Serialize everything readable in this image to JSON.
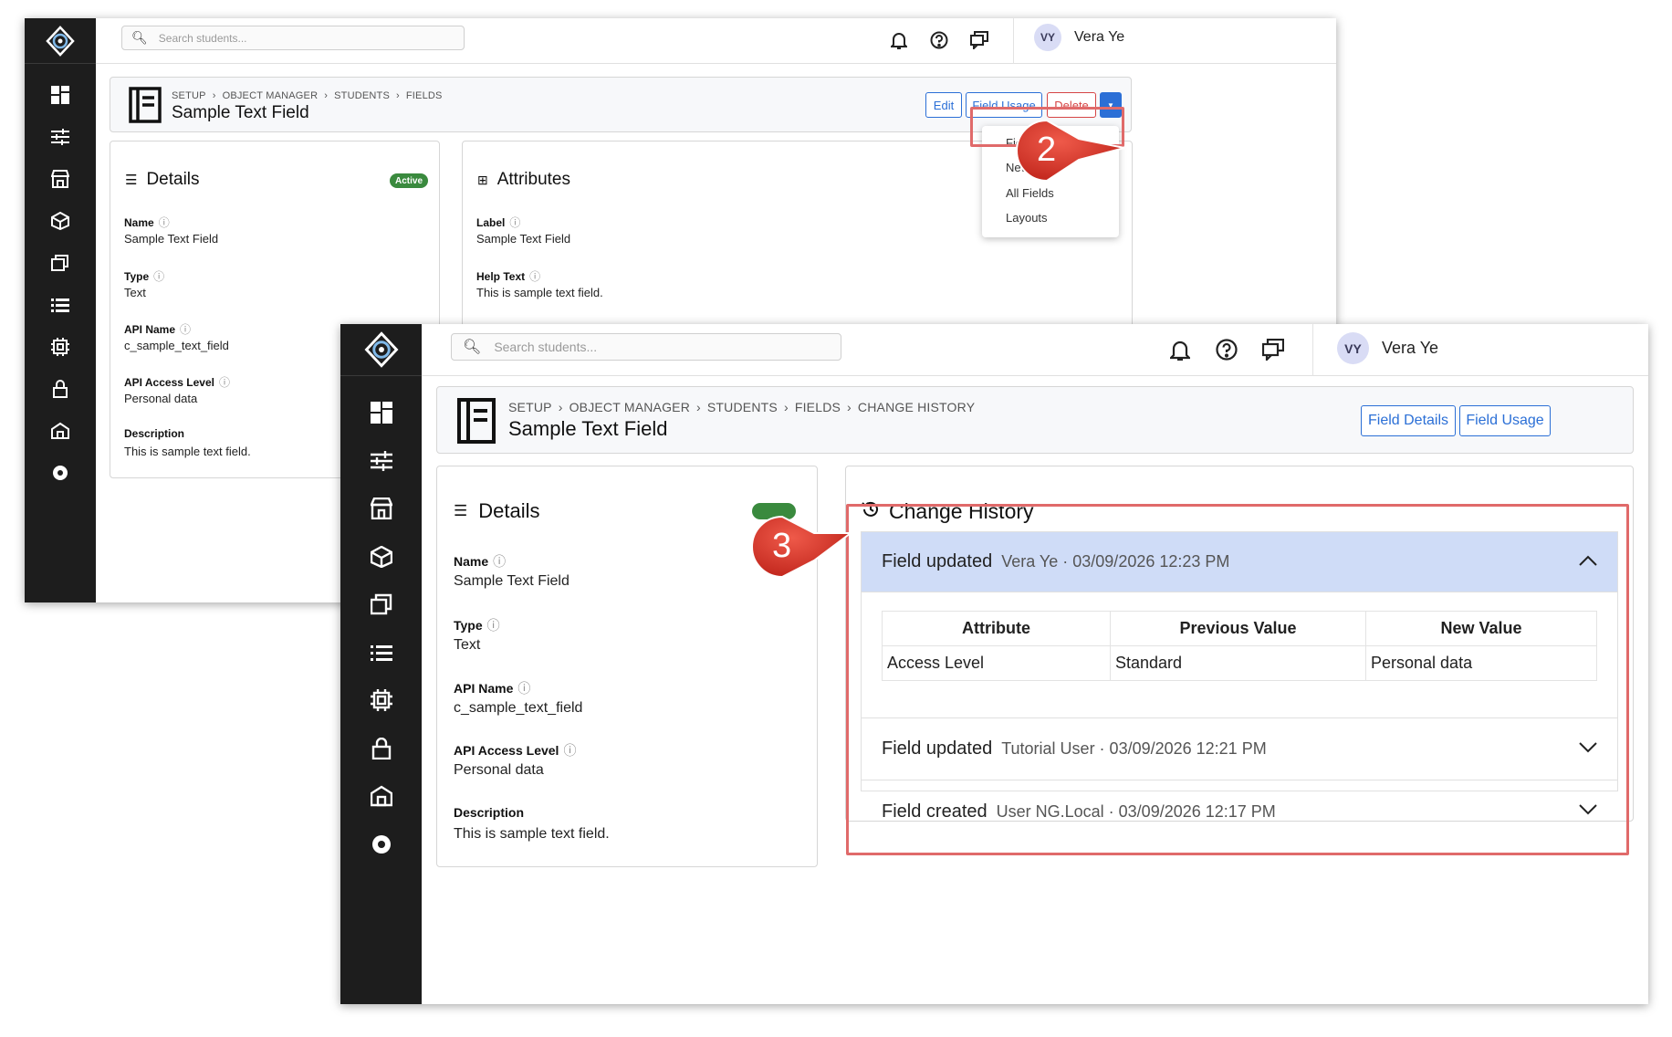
{
  "app": {
    "search_placeholder": "Search students...",
    "user_initials": "VY",
    "user_name": "Vera Ye"
  },
  "shot1": {
    "breadcrumb": [
      "SETUP",
      "OBJECT MANAGER",
      "STUDENTS",
      "FIELDS"
    ],
    "title": "Sample Text Field",
    "buttons": {
      "edit": "Edit",
      "field_usage": "Field Usage",
      "delete": "Delete"
    },
    "menu": [
      "Field Logs",
      "New Field",
      "All Fields",
      "Layouts"
    ],
    "details": {
      "heading": "Details",
      "badge": "Active",
      "fields": [
        {
          "label": "Name",
          "value": "Sample Text Field"
        },
        {
          "label": "Type",
          "value": "Text"
        },
        {
          "label": "API Name",
          "value": "c_sample_text_field"
        },
        {
          "label": "API Access Level",
          "value": "Personal data"
        },
        {
          "label": "Description",
          "value": "This is sample text field."
        }
      ]
    },
    "attributes": {
      "heading": "Attributes",
      "fields": [
        {
          "label": "Label",
          "value": "Sample Text Field"
        },
        {
          "label": "Help Text",
          "value": "This is sample text field."
        }
      ]
    },
    "step": "2"
  },
  "shot2": {
    "breadcrumb": [
      "SETUP",
      "OBJECT MANAGER",
      "STUDENTS",
      "FIELDS",
      "CHANGE HISTORY"
    ],
    "title": "Sample Text Field",
    "buttons": {
      "field_details": "Field Details",
      "field_usage": "Field Usage"
    },
    "details": {
      "heading": "Details",
      "fields": [
        {
          "label": "Name",
          "value": "Sample Text Field"
        },
        {
          "label": "Type",
          "value": "Text"
        },
        {
          "label": "API Name",
          "value": "c_sample_text_field"
        },
        {
          "label": "API Access Level",
          "value": "Personal data"
        },
        {
          "label": "Description",
          "value": "This is sample text field."
        }
      ]
    },
    "history": {
      "heading": "Change History",
      "entries": [
        {
          "title": "Field updated",
          "meta": "Vera Ye · 03/09/2026 12:23 PM",
          "expanded": true
        },
        {
          "title": "Field updated",
          "meta": "Tutorial User · 03/09/2026 12:21 PM",
          "expanded": false
        },
        {
          "title": "Field created",
          "meta": "User NG.Local · 03/09/2026 12:17 PM",
          "expanded": false
        }
      ],
      "table": {
        "headers": [
          "Attribute",
          "Previous Value",
          "New Value"
        ],
        "rows": [
          [
            "Access Level",
            "Standard",
            "Personal data"
          ]
        ]
      }
    },
    "step": "3"
  },
  "colors": {
    "accent": "#2b6fd6",
    "danger": "#d64545",
    "callout": "#e06a6a",
    "sidebar": "#1d1d1d",
    "expanded_row": "#cfdcf7",
    "active_badge": "#3a8a3e"
  }
}
